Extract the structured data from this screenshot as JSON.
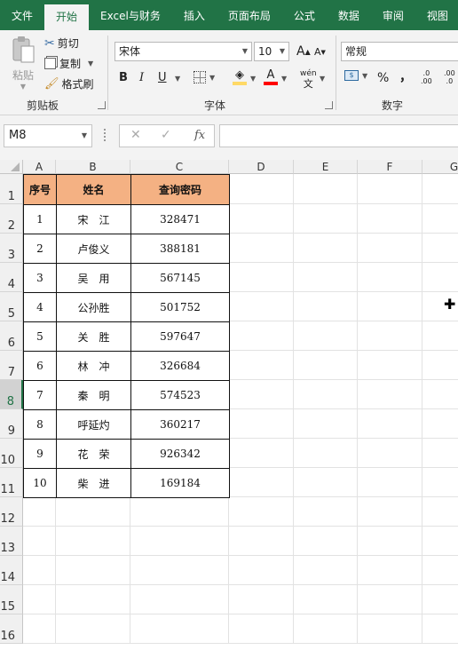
{
  "tabs": [
    "文件",
    "开始",
    "Excel与财务",
    "插入",
    "页面布局",
    "公式",
    "数据",
    "审阅",
    "视图"
  ],
  "clipboard": {
    "paste": "粘贴",
    "cut": "剪切",
    "copy": "复制",
    "format_painter": "格式刷",
    "label": "剪贴板"
  },
  "font": {
    "name": "宋体",
    "size": "10",
    "grow": "A",
    "shrink": "A",
    "bold": "B",
    "italic": "I",
    "underline": "U",
    "phonetic": "wén",
    "phonetic_sub": "文",
    "label": "字体",
    "fill_color": "#ffd966",
    "font_color": "#ff0000"
  },
  "number": {
    "format": "常规",
    "percent": "%",
    "comma": "，",
    "label": "数字",
    "inc": ".00",
    "dec": ".0"
  },
  "formula_bar": {
    "name_box": "M8",
    "cancel": "✕",
    "enter": "✓",
    "fx": "fx",
    "value": ""
  },
  "columns": [
    "A",
    "B",
    "C",
    "D",
    "E",
    "F",
    "G"
  ],
  "rows": [
    "1",
    "2",
    "3",
    "4",
    "5",
    "6",
    "7",
    "8",
    "9",
    "10",
    "11",
    "12",
    "13",
    "14",
    "15",
    "16"
  ],
  "table": {
    "headers": [
      "序号",
      "姓名",
      "查询密码"
    ],
    "header_color": "#f4b183",
    "rows": [
      [
        "1",
        "宋　江",
        "328471"
      ],
      [
        "2",
        "卢俊义",
        "388181"
      ],
      [
        "3",
        "吴　用",
        "567145"
      ],
      [
        "4",
        "公孙胜",
        "501752"
      ],
      [
        "5",
        "关　胜",
        "597647"
      ],
      [
        "6",
        "林　冲",
        "326684"
      ],
      [
        "7",
        "秦　明",
        "574523"
      ],
      [
        "8",
        "呼延灼",
        "360217"
      ],
      [
        "9",
        "花　荣",
        "926342"
      ],
      [
        "10",
        "柴　进",
        "169184"
      ]
    ]
  },
  "accent": "#217346",
  "active_cell": "M8"
}
